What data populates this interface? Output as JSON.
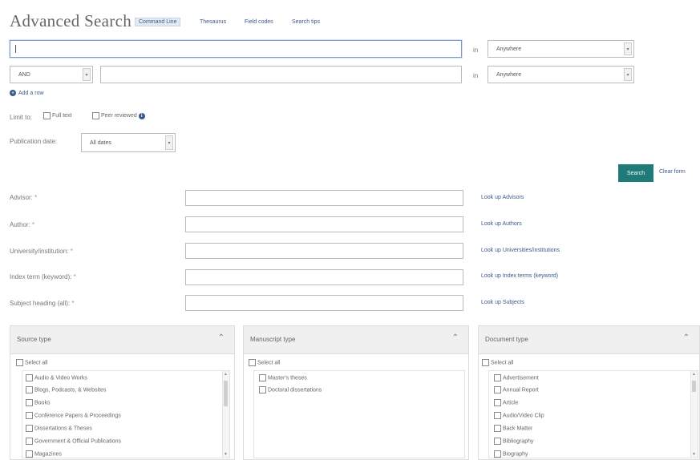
{
  "header": {
    "title": "Advanced Search",
    "tabs": [
      "Command Line",
      "Thesaurus",
      "Field codes",
      "Search tips"
    ]
  },
  "search_rows": [
    {
      "value": "",
      "in_label": "in",
      "field": "Anywhere"
    },
    {
      "operator": "AND",
      "value": "",
      "in_label": "in",
      "field": "Anywhere"
    }
  ],
  "add_row": "Add a row",
  "limit": {
    "label": "Limit to:",
    "full_text": "Full text",
    "peer_reviewed": "Peer reviewed"
  },
  "pubdate": {
    "label": "Publication date:",
    "value": "All dates"
  },
  "actions": {
    "search": "Search",
    "clear": "Clear form"
  },
  "lookup_fields": [
    {
      "label": "Advisor:",
      "link": "Look up Advisors"
    },
    {
      "label": "Author:",
      "link": "Look up Authors"
    },
    {
      "label": "University/institution:",
      "link": "Look up Universities/institutions"
    },
    {
      "label": "Index term (keyword):",
      "link": "Look up Index terms (keyword)"
    },
    {
      "label": "Subject heading (all):",
      "link": "Look up Subjects"
    }
  ],
  "required_mark": "*",
  "panels": {
    "source": {
      "title": "Source type",
      "select_all": "Select all",
      "items": [
        "Audio & Video Works",
        "Blogs, Podcasts, & Websites",
        "Books",
        "Conference Papers & Proceedings",
        "Dissertations & Theses",
        "Government & Official Publications",
        "Magazines"
      ]
    },
    "manuscript": {
      "title": "Manuscript type",
      "select_all": "Select all",
      "items": [
        "Master's theses",
        "Doctoral dissertations"
      ]
    },
    "document": {
      "title": "Document type",
      "select_all": "Select all",
      "items": [
        "Advertisement",
        "Annual Report",
        "Article",
        "Audio/Video Clip",
        "Back Matter",
        "Bibliography",
        "Biography"
      ]
    }
  },
  "colors": {
    "accent": "#1e7b79",
    "link": "#3b5a86"
  },
  "icons": {
    "info": "info-icon",
    "add": "plus-circle-icon",
    "chevron": "chevron-up-icon"
  }
}
